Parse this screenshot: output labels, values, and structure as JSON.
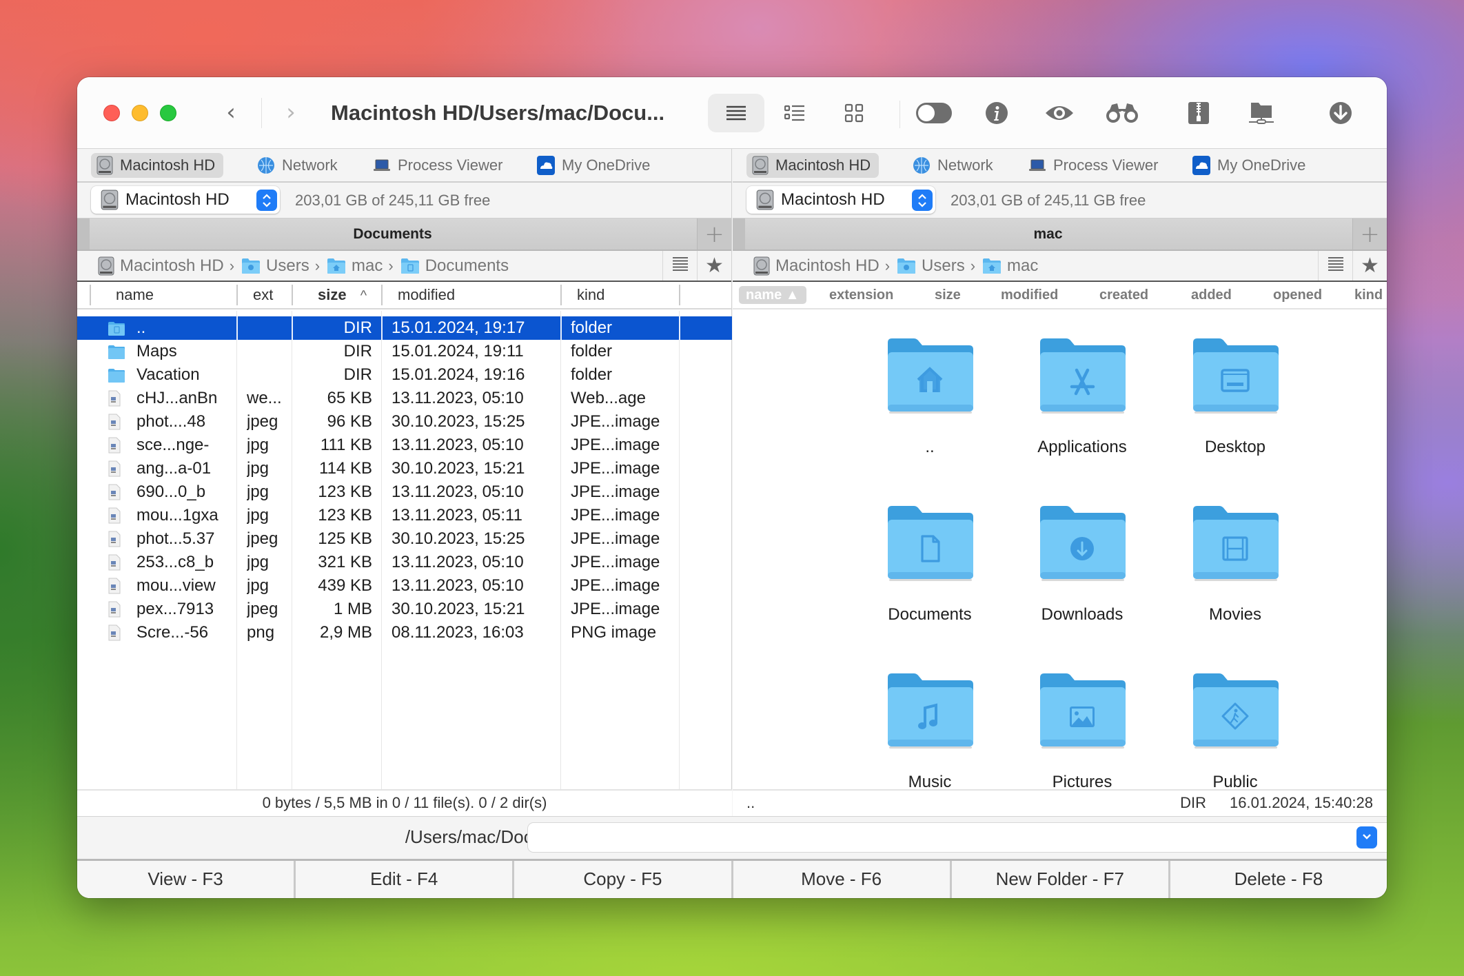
{
  "window": {
    "title": "Macintosh HD/Users/mac/Docu...",
    "nav": {
      "back": "‹",
      "forward": "›"
    },
    "toolbar_icons": [
      "list-view-icon",
      "detail-list-view-icon",
      "grid-view-icon",
      "toggle-hidden-icon",
      "info-icon",
      "quick-look-icon",
      "search-binoculars-icon",
      "archive-zip-icon",
      "network-folder-icon",
      "download-icon"
    ]
  },
  "tabs": [
    "Macintosh HD",
    "Network",
    "Process Viewer",
    "My OneDrive"
  ],
  "left": {
    "drive": "Macintosh HD",
    "free_space": "203,01 GB of 245,11 GB free",
    "pane_title": "Documents",
    "breadcrumb": [
      "Macintosh HD",
      "Users",
      "mac",
      "Documents"
    ],
    "columns": {
      "name": "name",
      "ext": "ext",
      "size": "size",
      "modified": "modified",
      "kind": "kind",
      "sort_indicator": "^"
    },
    "rows": [
      {
        "icon": "folder-documents",
        "name": "..",
        "ext": "",
        "size": "DIR",
        "modified": "15.01.2024, 19:17",
        "kind": "folder",
        "selected": true
      },
      {
        "icon": "folder",
        "name": "Maps",
        "ext": "",
        "size": "DIR",
        "modified": "15.01.2024, 19:11",
        "kind": "folder"
      },
      {
        "icon": "folder",
        "name": "Vacation",
        "ext": "",
        "size": "DIR",
        "modified": "15.01.2024, 19:16",
        "kind": "folder"
      },
      {
        "icon": "image-file",
        "name": "cHJ...anBn",
        "ext": "we...",
        "size": "65 KB",
        "modified": "13.11.2023, 05:10",
        "kind": "Web...age"
      },
      {
        "icon": "image-file",
        "name": "phot....48",
        "ext": "jpeg",
        "size": "96 KB",
        "modified": "30.10.2023, 15:25",
        "kind": "JPE...image"
      },
      {
        "icon": "image-file",
        "name": "sce...nge-",
        "ext": "jpg",
        "size": "111 KB",
        "modified": "13.11.2023, 05:10",
        "kind": "JPE...image"
      },
      {
        "icon": "image-file",
        "name": "ang...a-01",
        "ext": "jpg",
        "size": "114 KB",
        "modified": "30.10.2023, 15:21",
        "kind": "JPE...image"
      },
      {
        "icon": "image-file",
        "name": "690...0_b",
        "ext": "jpg",
        "size": "123 KB",
        "modified": "13.11.2023, 05:10",
        "kind": "JPE...image"
      },
      {
        "icon": "image-file",
        "name": "mou...1gxa",
        "ext": "jpg",
        "size": "123 KB",
        "modified": "13.11.2023, 05:11",
        "kind": "JPE...image"
      },
      {
        "icon": "image-file",
        "name": "phot...5.37",
        "ext": "jpeg",
        "size": "125 KB",
        "modified": "30.10.2023, 15:25",
        "kind": "JPE...image"
      },
      {
        "icon": "image-file",
        "name": "253...c8_b",
        "ext": "jpg",
        "size": "321 KB",
        "modified": "13.11.2023, 05:10",
        "kind": "JPE...image"
      },
      {
        "icon": "image-file",
        "name": "mou...view",
        "ext": "jpg",
        "size": "439 KB",
        "modified": "13.11.2023, 05:10",
        "kind": "JPE...image"
      },
      {
        "icon": "image-file",
        "name": "pex...7913",
        "ext": "jpeg",
        "size": "1 MB",
        "modified": "30.10.2023, 15:21",
        "kind": "JPE...image"
      },
      {
        "icon": "image-file",
        "name": "Scre...-56",
        "ext": "png",
        "size": "2,9 MB",
        "modified": "08.11.2023, 16:03",
        "kind": "PNG image"
      }
    ],
    "status": "0 bytes / 5,5 MB in 0 / 11 file(s). 0 / 2 dir(s)"
  },
  "right": {
    "drive": "Macintosh HD",
    "free_space": "203,01 GB of 245,11 GB free",
    "pane_title": "mac",
    "breadcrumb": [
      "Macintosh HD",
      "Users",
      "mac"
    ],
    "columns": [
      "name ▲",
      "extension",
      "size",
      "modified",
      "created",
      "added",
      "opened",
      "kind"
    ],
    "items": [
      {
        "label": "..",
        "glyph": "home"
      },
      {
        "label": "Applications",
        "glyph": "apps"
      },
      {
        "label": "Desktop",
        "glyph": "desktop"
      },
      {
        "label": "Documents",
        "glyph": "document"
      },
      {
        "label": "Downloads",
        "glyph": "download"
      },
      {
        "label": "Movies",
        "glyph": "film"
      },
      {
        "label": "Music",
        "glyph": "music"
      },
      {
        "label": "Pictures",
        "glyph": "picture"
      },
      {
        "label": "Public",
        "glyph": "public"
      }
    ],
    "status_name": "..",
    "status_kind": "DIR",
    "status_date": "16.01.2024, 15:40:28"
  },
  "command_line": {
    "path": "/Users/mac/Documents",
    "value": ""
  },
  "function_keys": [
    "View - F3",
    "Edit - F4",
    "Copy - F5",
    "Move - F6",
    "New Folder - F7",
    "Delete - F8"
  ],
  "colors": {
    "selection": "#0b55d0",
    "accent": "#1f7cf7",
    "folder": "#6fc8f6"
  }
}
